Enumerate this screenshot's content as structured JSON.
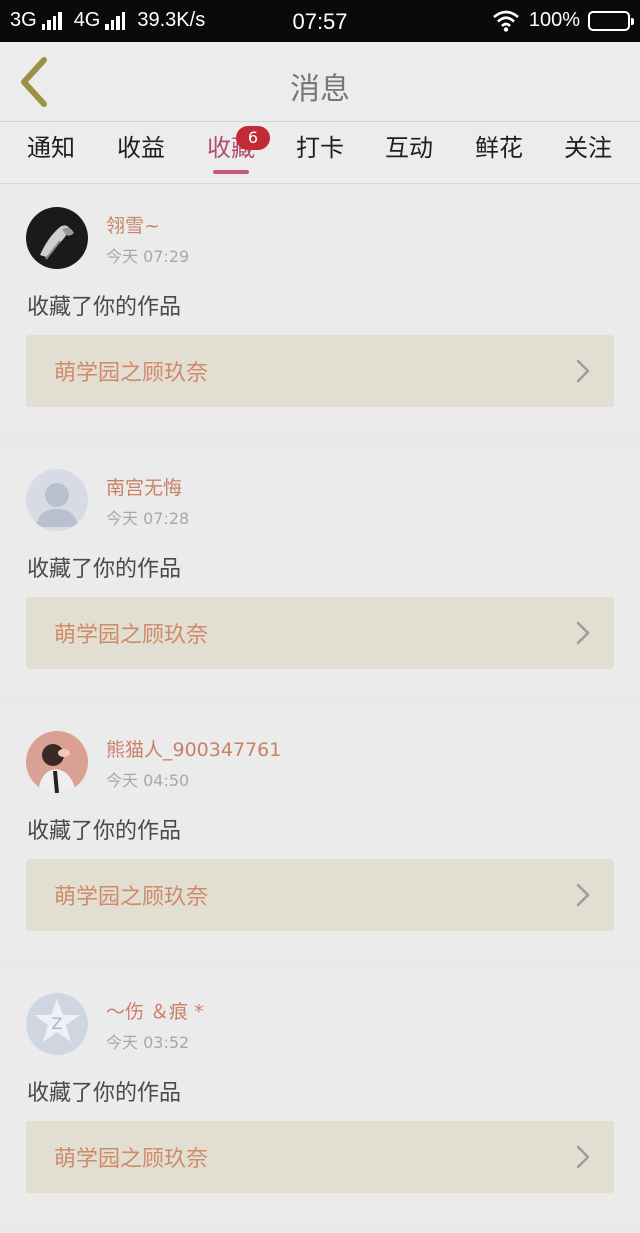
{
  "status_bar": {
    "net1": "3G",
    "net2": "4G",
    "speed": "39.3K/s",
    "time": "07:57",
    "battery": "100%"
  },
  "nav": {
    "title": "消息",
    "back_icon": "chevron-left-icon"
  },
  "tabs": [
    {
      "label": "通知"
    },
    {
      "label": "收益"
    },
    {
      "label": "收藏",
      "badge": "6",
      "active": true
    },
    {
      "label": "打卡"
    },
    {
      "label": "互动"
    },
    {
      "label": "鲜花"
    },
    {
      "label": "关注"
    }
  ],
  "messages": [
    {
      "username": "翎雪~",
      "time": "今天 07:29",
      "action": "收藏了你的作品",
      "work": "萌学园之顾玖奈"
    },
    {
      "username": "南宫无悔",
      "time": "今天 07:28",
      "action": "收藏了你的作品",
      "work": "萌学园之顾玖奈"
    },
    {
      "username": "熊猫人_900347761",
      "time": "今天 04:50",
      "action": "收藏了你的作品",
      "work": "萌学园之顾玖奈"
    },
    {
      "username": "～伤 ＆痕 *",
      "time": "今天 03:52",
      "action": "收藏了你的作品",
      "work": "萌学园之顾玖奈"
    }
  ],
  "colors": {
    "accent": "#c65b79",
    "badge": "#c22a36",
    "username": "#c98167",
    "work_title": "#cf8a6a"
  }
}
